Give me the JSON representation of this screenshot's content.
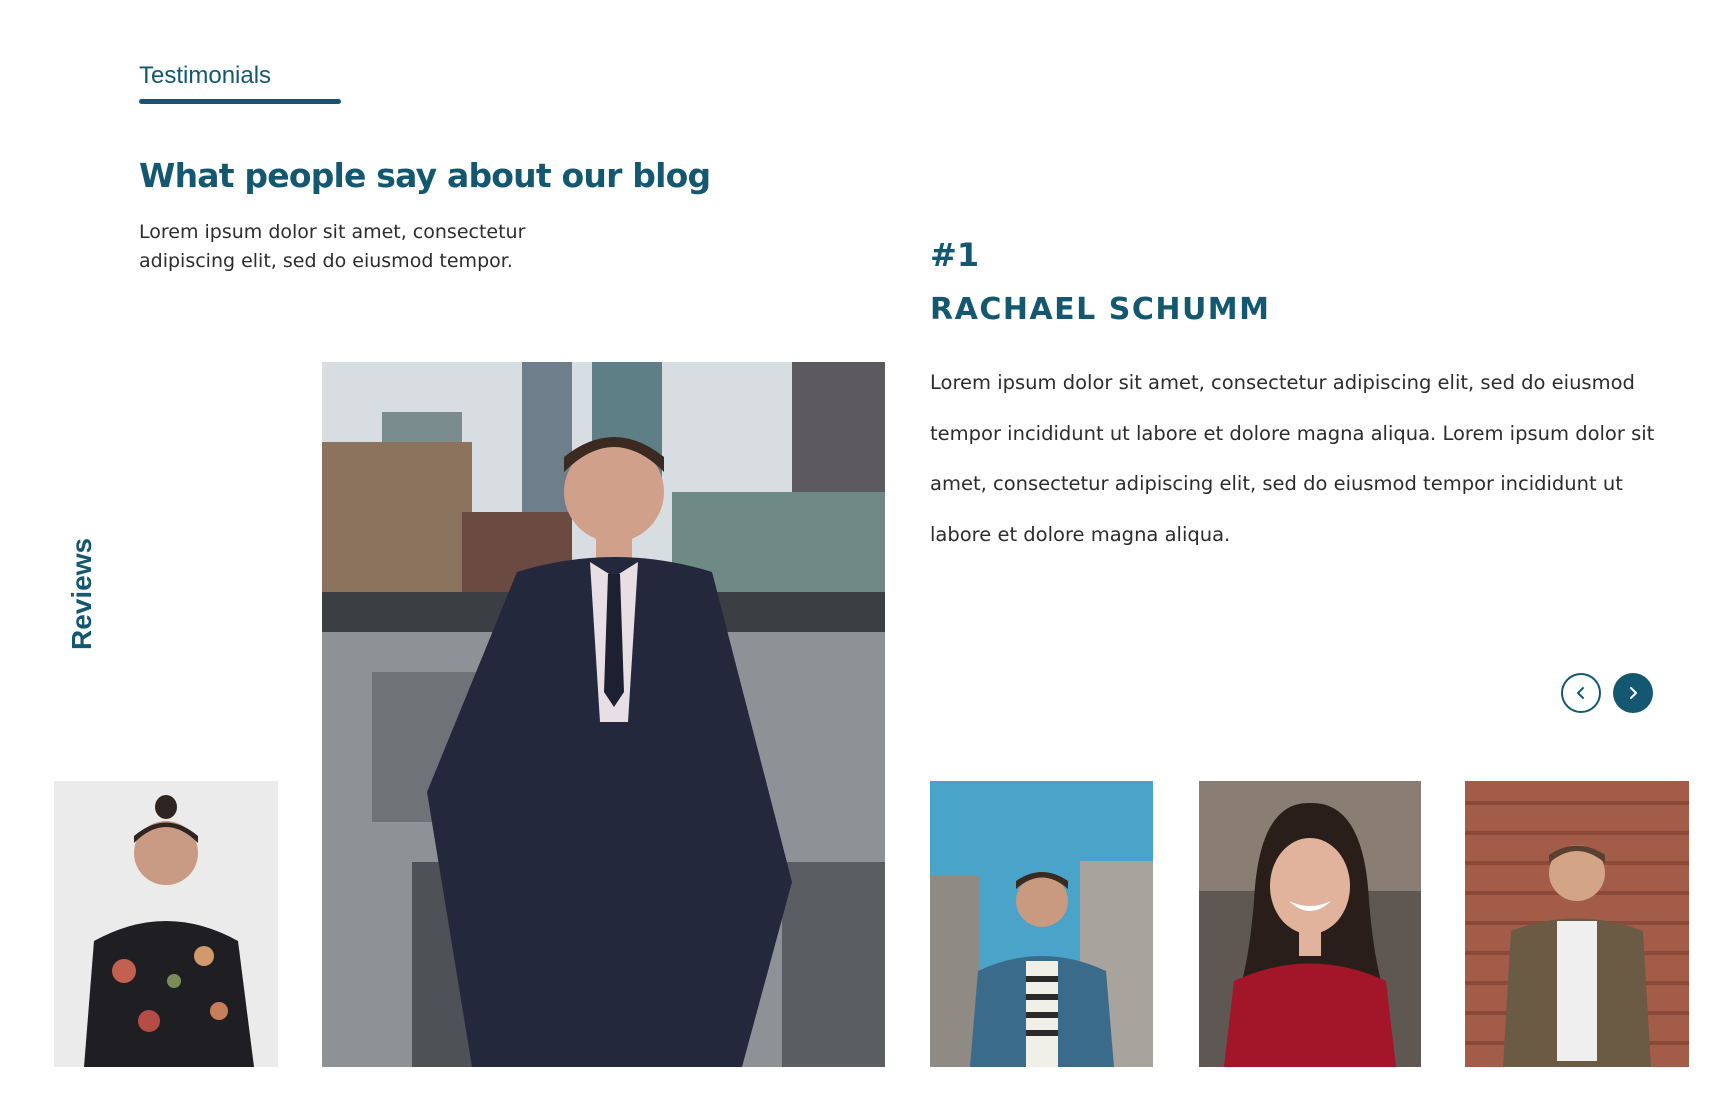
{
  "section": {
    "eyebrow": "Testimonials",
    "heading": "What people say about our blog",
    "intro": "Lorem ipsum dolor sit amet, consectetur adipiscing elit, sed do eiusmod tempor.",
    "side_label": "Reviews"
  },
  "testimonial": {
    "rank": "#1",
    "name": "RACHAEL SCHUMM",
    "quote": "Lorem ipsum dolor sit amet, consectetur adipiscing elit, sed do eiusmod tempor incididunt ut labore et dolore magna aliqua. Lorem ipsum dolor sit amet, consectetur adipiscing elit, sed do eiusmod tempor incididunt ut labore et dolore magna aliqua."
  },
  "controls": {
    "prev_icon": "chevron-left-icon",
    "next_icon": "chevron-right-icon"
  },
  "theme": {
    "accent": "#135870",
    "text": "#2c2c2c",
    "background": "#ffffff"
  }
}
